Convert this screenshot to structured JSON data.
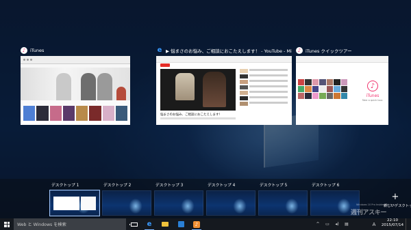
{
  "windows": [
    {
      "title": "iTunes",
      "app": "itunes"
    },
    {
      "title": "▶ 悩まさのお悩み、ご相談におこたえします！ - YouTube - Microsoft Edge",
      "app": "edge",
      "content": {
        "video_title": "悩まさのお悩み、ご相談におこたえします！"
      }
    },
    {
      "title": "iTunes クイックツアー",
      "app": "itunes",
      "content": {
        "app_name": "iTunes",
        "subtitle": "Take a quick tour."
      }
    }
  ],
  "desktops": [
    {
      "label": "デスクトップ 1",
      "active": true
    },
    {
      "label": "デスクトップ 2",
      "active": false
    },
    {
      "label": "デスクトップ 3",
      "active": false
    },
    {
      "label": "デスクトップ 4",
      "active": false
    },
    {
      "label": "デスクトップ 5",
      "active": false
    },
    {
      "label": "デスクトップ 6",
      "active": false
    }
  ],
  "new_desktop": {
    "icon": "plus-icon",
    "label": "新しいデスクトップ"
  },
  "watermark": {
    "small": "Windows 10 Pro Insider Preview",
    "logo": "週刊アスキー"
  },
  "taskbar": {
    "search_placeholder": "Web と Windows を検索",
    "pinned": [
      "task-view-icon",
      "edge-icon",
      "file-explorer-icon",
      "store-icon",
      "itunes-icon"
    ],
    "ime": "A",
    "clock_time": "22:10",
    "clock_date": "2015/07/14"
  }
}
